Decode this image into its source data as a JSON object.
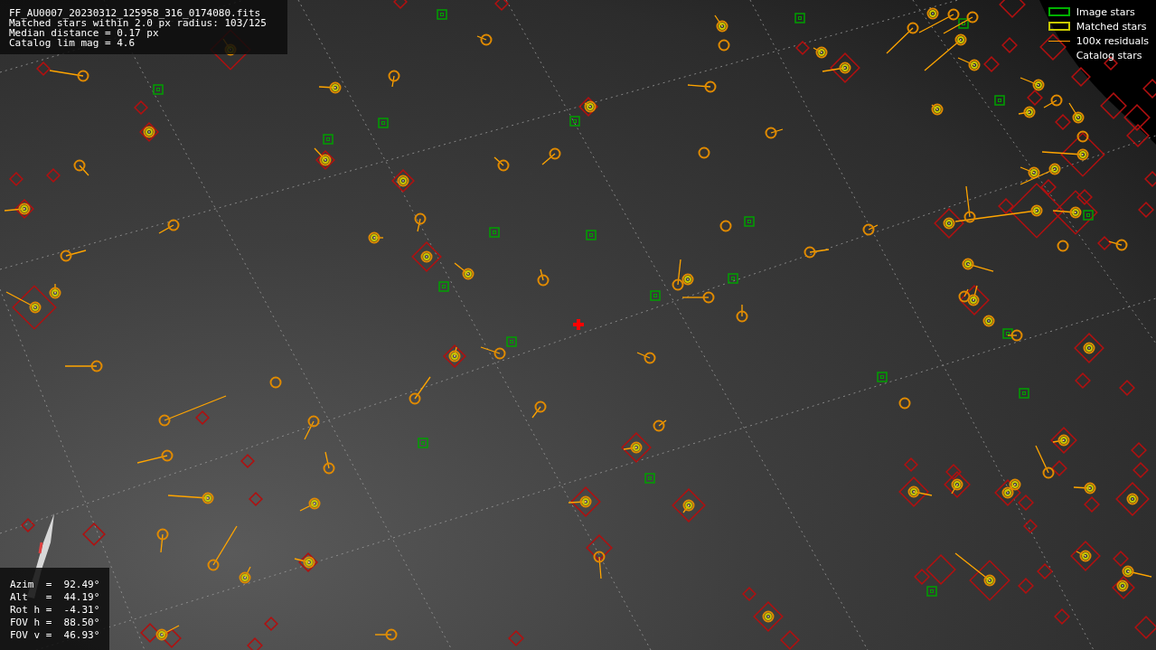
{
  "info_panel": {
    "lines": [
      "FF_AU0007_20230312_125958_316_0174080.fits",
      "Matched stars within 2.0 px radius: 103/125",
      "Median distance = 0.17 px",
      "Catalog lim mag = 4.6"
    ]
  },
  "legend": [
    {
      "kind": "rect",
      "color": "#00b000",
      "label": "Image stars"
    },
    {
      "kind": "rect",
      "color": "#c8c800",
      "label": "Matched stars"
    },
    {
      "kind": "line",
      "color": "#ff9900",
      "label": "100x residuals"
    },
    {
      "kind": "blank",
      "label": "Catalog stars"
    }
  ],
  "pointing_panel": {
    "lines": [
      "Azim  =  92.49°",
      "Alt   =  44.19°",
      "Rot h =  -4.31°",
      "FOV h =  88.50°",
      "FOV v =  46.93°"
    ]
  }
}
